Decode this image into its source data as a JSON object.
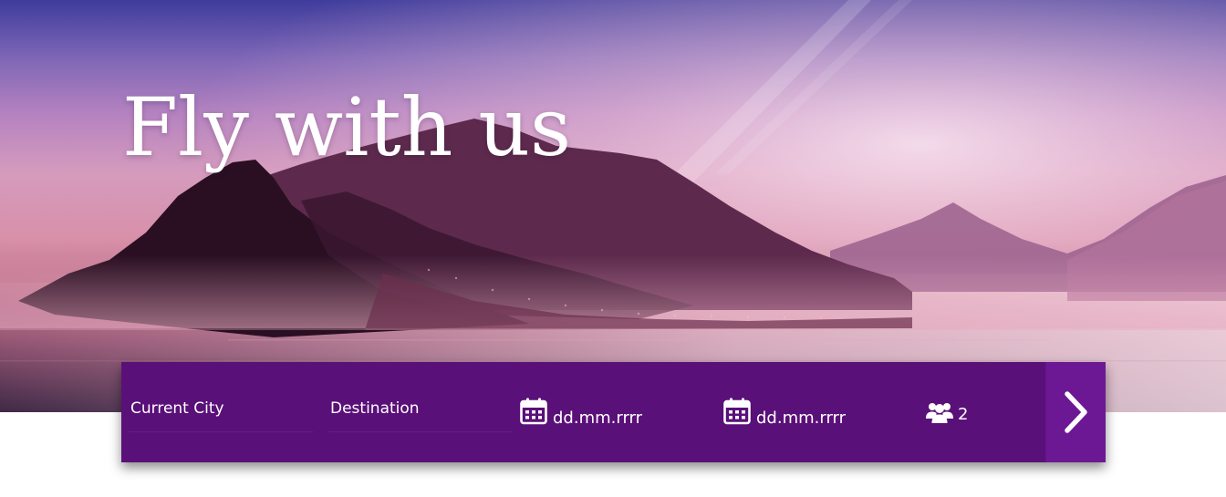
{
  "hero": {
    "title": "Fly with us"
  },
  "search": {
    "origin": {
      "placeholder": "Current City",
      "icon": "none"
    },
    "destination": {
      "placeholder": "Destination",
      "icon": "none"
    },
    "departure_date": {
      "placeholder": "dd.mm.rrrr",
      "icon": "calendar-icon"
    },
    "return_date": {
      "placeholder": "dd.mm.rrrr",
      "icon": "calendar-icon"
    },
    "passengers": {
      "value": "2",
      "icon": "users-icon"
    },
    "submit": {
      "icon": "chevron-right-icon"
    }
  },
  "colors": {
    "bar_background": "#5a1079",
    "submit_background": "#6c1895",
    "text": "#ffffff"
  }
}
